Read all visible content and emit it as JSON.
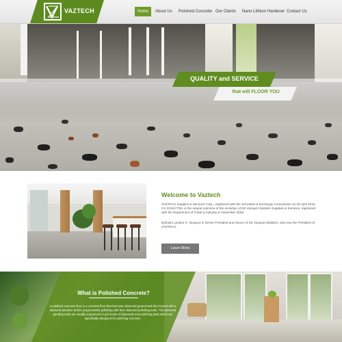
{
  "brand": {
    "name": "VAZTECH",
    "colors": {
      "accent": "#5f8d20",
      "nav_active": "#6e9c2a",
      "button": "#777777"
    }
  },
  "nav": {
    "items": [
      {
        "label": "Home",
        "active": true
      },
      {
        "label": "About Us",
        "active": false
      },
      {
        "label": "Polished Concrete",
        "active": false
      },
      {
        "label": "Our Clients",
        "active": false
      },
      {
        "label": "Nano Lithium Hardener",
        "active": false
      },
      {
        "label": "Contact Us",
        "active": false
      }
    ]
  },
  "hero": {
    "tagline_1": "QUALITY and SERVICE",
    "tagline_2": "that will FLOOR YOU"
  },
  "welcome": {
    "title": "Welcome to Vaztech",
    "paragraph_1": "VAZTECH Supplies & Services Corp., registered with the Securities & Exchange Commission on 28 April 2010, CS 201017755, is the natural outcome of the evolution of DZ Vazquez Builders Supplies & Services, registered with the Department of Trade & Industry in November 2006.",
    "paragraph_2": "Ephraim Lyndon S. Vazquez is former President and Owner of DZ Vazquez Builders, and now the President of VAZTECH.",
    "button_label": "Learn More"
  },
  "polished": {
    "title": "What is Polished Concrete?",
    "text": "A polished concrete floor is a concrete floor that has been diamond ground and then honed with a diamond abrasive before progressively polishing with finer diamond polishing tools. This diamond grinding tools are usually sequenced in grit levels of diamonds and polishing pads which are specifically designed for polishing concrete."
  }
}
